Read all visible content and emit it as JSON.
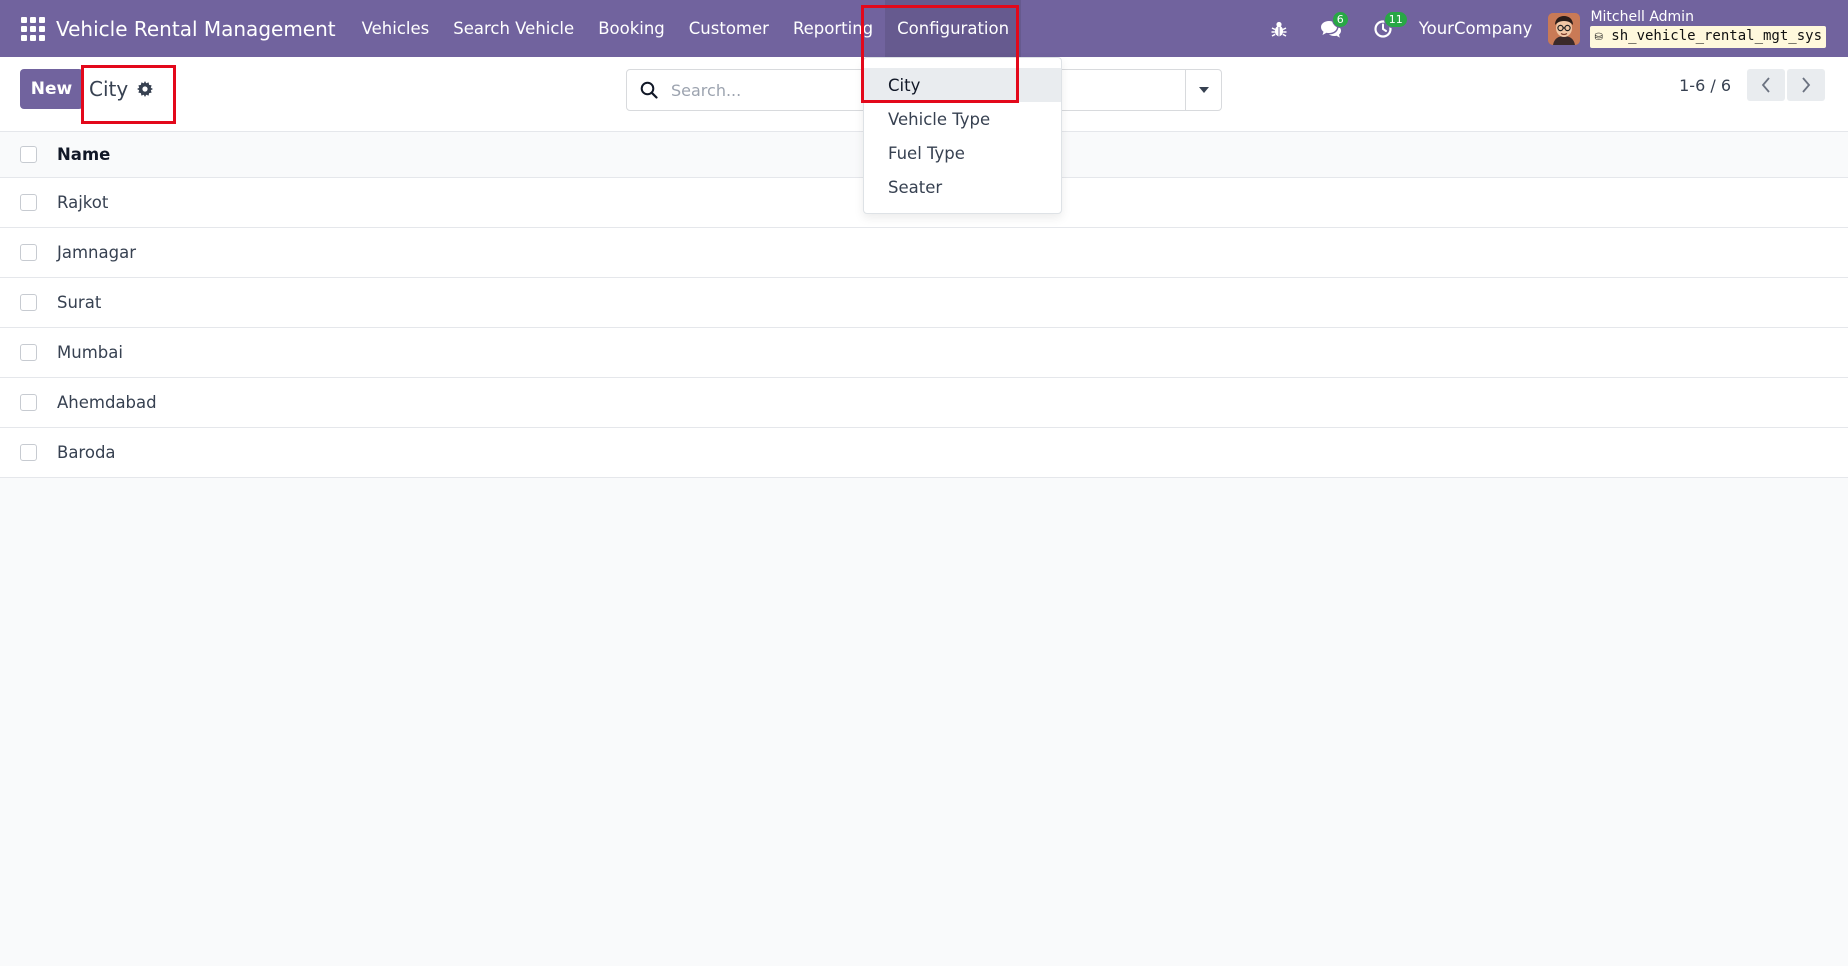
{
  "navbar": {
    "brand": "Vehicle Rental Management",
    "menu": [
      {
        "label": "Vehicles"
      },
      {
        "label": "Search Vehicle"
      },
      {
        "label": "Booking"
      },
      {
        "label": "Customer"
      },
      {
        "label": "Reporting"
      },
      {
        "label": "Configuration"
      }
    ],
    "messages_count": "6",
    "activities_count": "11",
    "company": "YourCompany",
    "user_name": "Mitchell Admin",
    "database": "sh_vehicle_rental_mgt_sys"
  },
  "control_panel": {
    "new_label": "New",
    "title": "City",
    "search_placeholder": "Search...",
    "pager": "1-6 / 6"
  },
  "list": {
    "header": "Name",
    "rows": [
      "Rajkot",
      "Jamnagar",
      "Surat",
      "Mumbai",
      "Ahemdabad",
      "Baroda"
    ]
  },
  "dropdown": {
    "items": [
      {
        "label": "City"
      },
      {
        "label": "Vehicle Type"
      },
      {
        "label": "Fuel Type"
      },
      {
        "label": "Seater"
      }
    ]
  },
  "colors": {
    "brand": "#71639e",
    "highlight": "#e3081b",
    "badge": "#28a745"
  }
}
